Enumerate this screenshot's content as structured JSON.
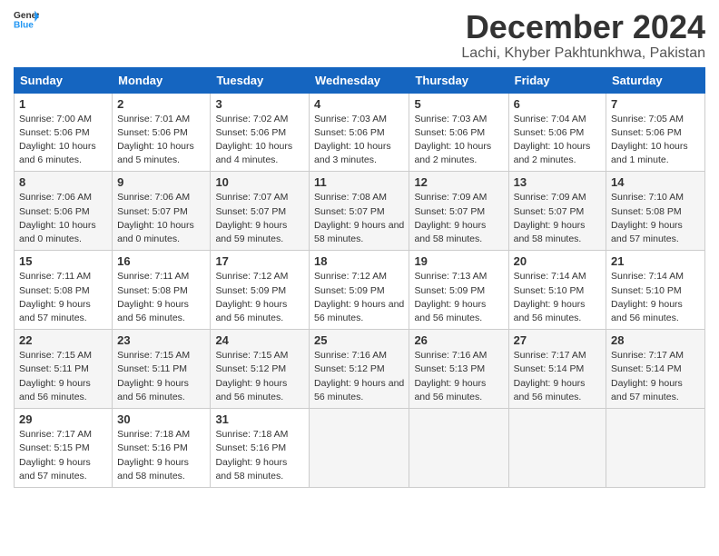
{
  "header": {
    "logo_general": "General",
    "logo_blue": "Blue",
    "month_year": "December 2024",
    "location": "Lachi, Khyber Pakhtunkhwa, Pakistan"
  },
  "columns": [
    "Sunday",
    "Monday",
    "Tuesday",
    "Wednesday",
    "Thursday",
    "Friday",
    "Saturday"
  ],
  "weeks": [
    [
      {
        "day": "1",
        "sunrise": "7:00 AM",
        "sunset": "5:06 PM",
        "daylight": "10 hours and 6 minutes."
      },
      {
        "day": "2",
        "sunrise": "7:01 AM",
        "sunset": "5:06 PM",
        "daylight": "10 hours and 5 minutes."
      },
      {
        "day": "3",
        "sunrise": "7:02 AM",
        "sunset": "5:06 PM",
        "daylight": "10 hours and 4 minutes."
      },
      {
        "day": "4",
        "sunrise": "7:03 AM",
        "sunset": "5:06 PM",
        "daylight": "10 hours and 3 minutes."
      },
      {
        "day": "5",
        "sunrise": "7:03 AM",
        "sunset": "5:06 PM",
        "daylight": "10 hours and 2 minutes."
      },
      {
        "day": "6",
        "sunrise": "7:04 AM",
        "sunset": "5:06 PM",
        "daylight": "10 hours and 2 minutes."
      },
      {
        "day": "7",
        "sunrise": "7:05 AM",
        "sunset": "5:06 PM",
        "daylight": "10 hours and 1 minute."
      }
    ],
    [
      {
        "day": "8",
        "sunrise": "7:06 AM",
        "sunset": "5:06 PM",
        "daylight": "10 hours and 0 minutes."
      },
      {
        "day": "9",
        "sunrise": "7:06 AM",
        "sunset": "5:07 PM",
        "daylight": "10 hours and 0 minutes."
      },
      {
        "day": "10",
        "sunrise": "7:07 AM",
        "sunset": "5:07 PM",
        "daylight": "9 hours and 59 minutes."
      },
      {
        "day": "11",
        "sunrise": "7:08 AM",
        "sunset": "5:07 PM",
        "daylight": "9 hours and 58 minutes."
      },
      {
        "day": "12",
        "sunrise": "7:09 AM",
        "sunset": "5:07 PM",
        "daylight": "9 hours and 58 minutes."
      },
      {
        "day": "13",
        "sunrise": "7:09 AM",
        "sunset": "5:07 PM",
        "daylight": "9 hours and 58 minutes."
      },
      {
        "day": "14",
        "sunrise": "7:10 AM",
        "sunset": "5:08 PM",
        "daylight": "9 hours and 57 minutes."
      }
    ],
    [
      {
        "day": "15",
        "sunrise": "7:11 AM",
        "sunset": "5:08 PM",
        "daylight": "9 hours and 57 minutes."
      },
      {
        "day": "16",
        "sunrise": "7:11 AM",
        "sunset": "5:08 PM",
        "daylight": "9 hours and 56 minutes."
      },
      {
        "day": "17",
        "sunrise": "7:12 AM",
        "sunset": "5:09 PM",
        "daylight": "9 hours and 56 minutes."
      },
      {
        "day": "18",
        "sunrise": "7:12 AM",
        "sunset": "5:09 PM",
        "daylight": "9 hours and 56 minutes."
      },
      {
        "day": "19",
        "sunrise": "7:13 AM",
        "sunset": "5:09 PM",
        "daylight": "9 hours and 56 minutes."
      },
      {
        "day": "20",
        "sunrise": "7:14 AM",
        "sunset": "5:10 PM",
        "daylight": "9 hours and 56 minutes."
      },
      {
        "day": "21",
        "sunrise": "7:14 AM",
        "sunset": "5:10 PM",
        "daylight": "9 hours and 56 minutes."
      }
    ],
    [
      {
        "day": "22",
        "sunrise": "7:15 AM",
        "sunset": "5:11 PM",
        "daylight": "9 hours and 56 minutes."
      },
      {
        "day": "23",
        "sunrise": "7:15 AM",
        "sunset": "5:11 PM",
        "daylight": "9 hours and 56 minutes."
      },
      {
        "day": "24",
        "sunrise": "7:15 AM",
        "sunset": "5:12 PM",
        "daylight": "9 hours and 56 minutes."
      },
      {
        "day": "25",
        "sunrise": "7:16 AM",
        "sunset": "5:12 PM",
        "daylight": "9 hours and 56 minutes."
      },
      {
        "day": "26",
        "sunrise": "7:16 AM",
        "sunset": "5:13 PM",
        "daylight": "9 hours and 56 minutes."
      },
      {
        "day": "27",
        "sunrise": "7:17 AM",
        "sunset": "5:14 PM",
        "daylight": "9 hours and 56 minutes."
      },
      {
        "day": "28",
        "sunrise": "7:17 AM",
        "sunset": "5:14 PM",
        "daylight": "9 hours and 57 minutes."
      }
    ],
    [
      {
        "day": "29",
        "sunrise": "7:17 AM",
        "sunset": "5:15 PM",
        "daylight": "9 hours and 57 minutes."
      },
      {
        "day": "30",
        "sunrise": "7:18 AM",
        "sunset": "5:16 PM",
        "daylight": "9 hours and 58 minutes."
      },
      {
        "day": "31",
        "sunrise": "7:18 AM",
        "sunset": "5:16 PM",
        "daylight": "9 hours and 58 minutes."
      },
      null,
      null,
      null,
      null
    ]
  ]
}
